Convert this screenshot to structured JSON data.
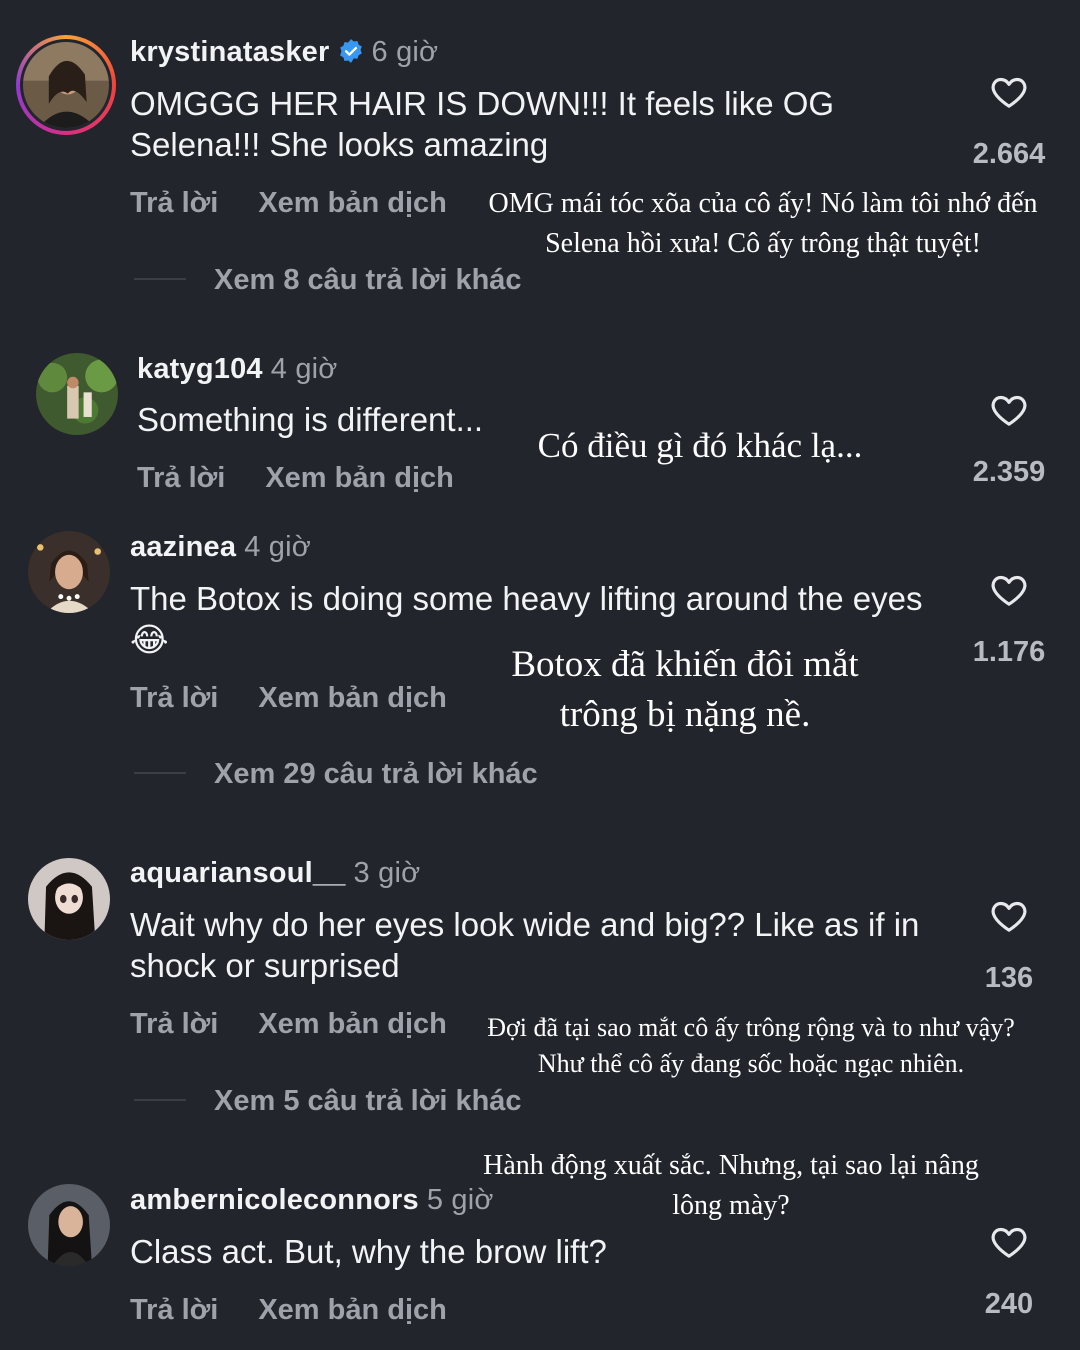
{
  "comments": [
    {
      "username": "krystinatasker",
      "verified": true,
      "time": "6 giờ",
      "text": "OMGGG HER HAIR IS DOWN!!! It feels like OG Selena!!! She looks amazing",
      "reply": "Trả lời",
      "translate": "Xem bản dịch",
      "likes": "2.664",
      "more_replies": "Xem 8 câu trả lời khác",
      "translation": "OMG mái tóc xõa của cô ấy! Nó làm tôi nhớ đến Selena hồi xưa! Cô ấy trông thật tuyệt!",
      "story_ring": true
    },
    {
      "username": "katyg104",
      "time": "4 giờ",
      "text": "Something is different...",
      "reply": "Trả lời",
      "translate": "Xem bản dịch",
      "likes": "2.359",
      "translation": "Có điều gì đó khác lạ..."
    },
    {
      "username": "aazinea",
      "time": "4 giờ",
      "text": "The Botox is doing some heavy lifting around the eyes 😂",
      "reply": "Trả lời",
      "translate": "Xem bản dịch",
      "likes": "1.176",
      "more_replies": "Xem 29 câu trả lời khác",
      "translation_line1": "Botox đã khiến đôi mắt",
      "translation_line2": "trông bị nặng nề."
    },
    {
      "username": "aquariansoul__",
      "time": "3 giờ",
      "text": "Wait why do her eyes look wide and big?? Like as if in shock or surprised",
      "reply": "Trả lời",
      "translate": "Xem bản dịch",
      "likes": "136",
      "more_replies": "Xem 5 câu trả lời khác",
      "translation_line1": "Đợi đã tại sao mắt cô ấy trông rộng và to như vậy?",
      "translation_line2": "Như thể cô ấy đang sốc hoặc ngạc nhiên."
    },
    {
      "username": "ambernicoleconnors",
      "time": "5 giờ",
      "text": "Class act. But, why the brow lift?",
      "reply": "Trả lời",
      "translate": "Xem bản dịch",
      "likes": "240",
      "translation_line1": "Hành động xuất sắc. Nhưng, tại sao lại nâng",
      "translation_line2": "lông mày?"
    }
  ],
  "colors": {
    "background": "#23252c",
    "muted_text": "#9ea2ab",
    "verified_badge": "#3897f0"
  },
  "icons": [
    "heart-outline-icon",
    "verified-badge-icon"
  ]
}
